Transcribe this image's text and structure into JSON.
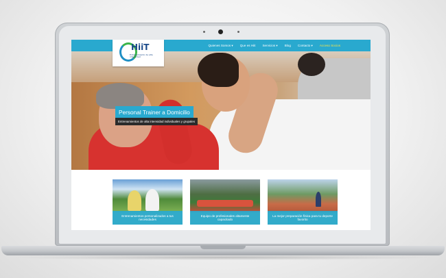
{
  "brand": {
    "logo_text": "HiiT",
    "logo_sub": "Entrenamiento de alta intensidad"
  },
  "nav": [
    {
      "label": "Quienes Somos ▾",
      "active": false
    },
    {
      "label": "Que es Hiit",
      "active": false
    },
    {
      "label": "Servicios ▾",
      "active": false
    },
    {
      "label": "Blog",
      "active": false
    },
    {
      "label": "Contacto ▾",
      "active": false
    },
    {
      "label": "Acceso Socios",
      "active": true
    }
  ],
  "hero": {
    "title": "Personal Trainer a Domicilio",
    "subtitle": "Entrenamientos de alta intensidad individuales y grupales",
    "slide_count": 4,
    "active_slide": 4
  },
  "cards": [
    {
      "caption": "Entrenamientos personalizados a tus necesidades"
    },
    {
      "caption": "Equipo de profesionales altamente capacitado"
    },
    {
      "caption": "La mejor preparación física para tu deporte favorito"
    }
  ],
  "colors": {
    "accent": "#29a9cf",
    "active_nav": "#f4e34a",
    "dark_caption": "#2b2b2b"
  }
}
